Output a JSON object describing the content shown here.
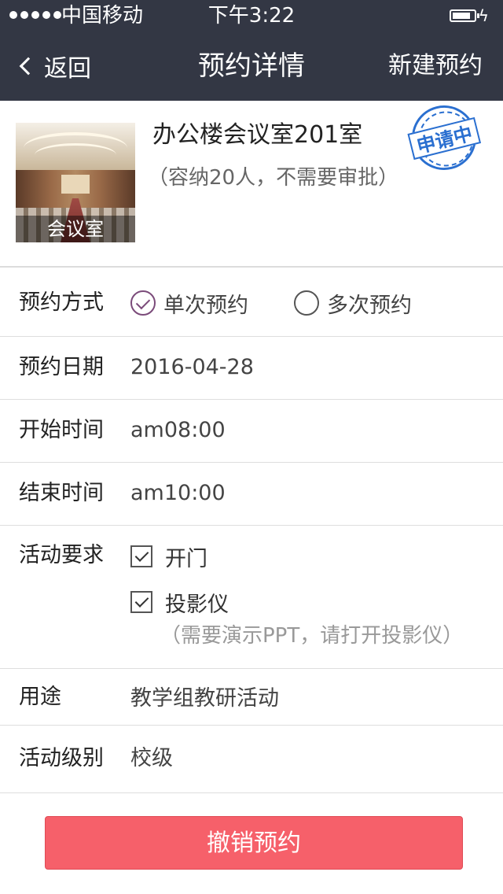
{
  "status_bar": {
    "carrier": "中国移动",
    "time": "下午3:22"
  },
  "nav": {
    "back_label": "返回",
    "title": "预约详情",
    "new_label": "新建预约"
  },
  "room": {
    "image_caption": "会议室",
    "name": "办公楼会议室201室",
    "note": "（容纳20人，不需要审批）",
    "stamp": "申请中"
  },
  "form": {
    "mode": {
      "label": "预约方式",
      "options": [
        {
          "label": "单次预约",
          "selected": true
        },
        {
          "label": "多次预约",
          "selected": false
        }
      ]
    },
    "date": {
      "label": "预约日期",
      "value": "2016-04-28"
    },
    "start": {
      "label": "开始时间",
      "value": "am08:00"
    },
    "end": {
      "label": "结束时间",
      "value": "am10:00"
    },
    "requirements": {
      "label": "活动要求",
      "items": [
        {
          "label": "开门",
          "checked": true
        },
        {
          "label": "投影仪",
          "checked": true
        }
      ],
      "note": "（需要演示PPT，请打开投影仪）"
    },
    "purpose": {
      "label": "用途",
      "value": "教学组教研活动"
    },
    "level": {
      "label": "活动级别",
      "value": "校级"
    }
  },
  "cancel_button": "撤销预约",
  "colors": {
    "header_bg": "#333744",
    "radio_accent": "#7b4b7a",
    "stamp_blue": "#2a6fd0",
    "cancel_bg": "#f6606a"
  }
}
